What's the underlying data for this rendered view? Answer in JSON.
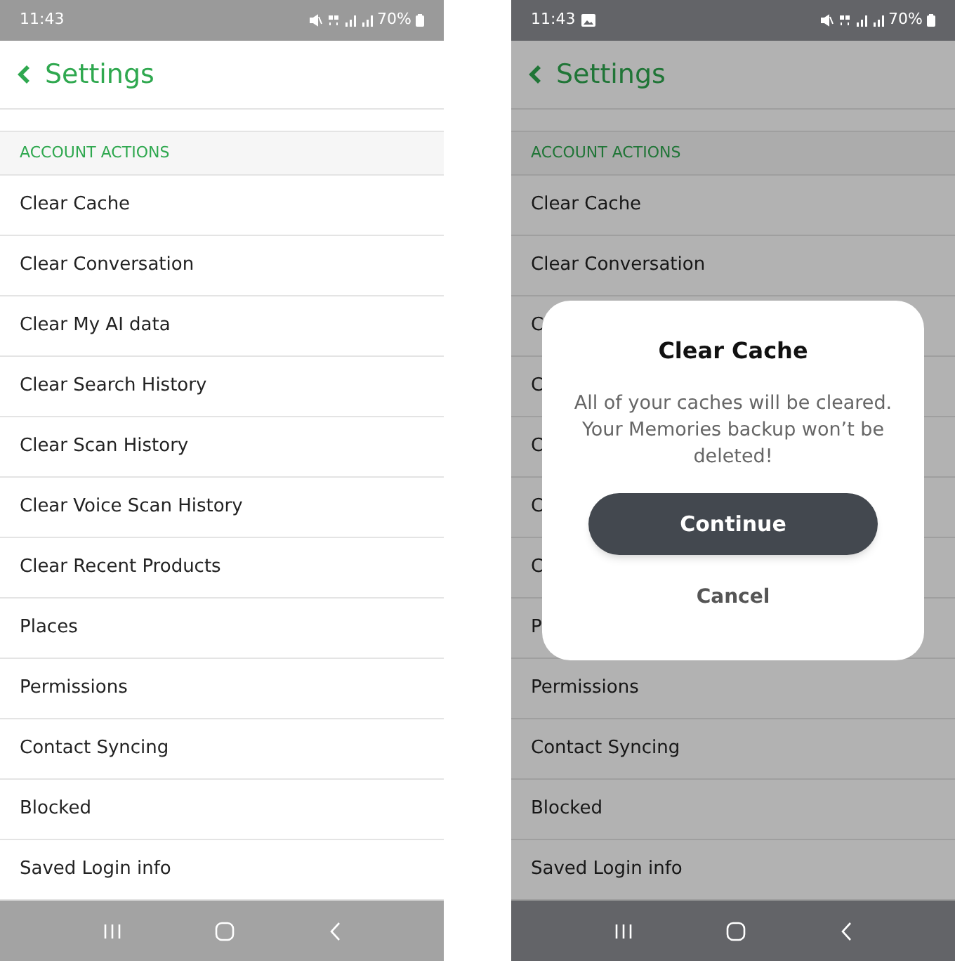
{
  "screens": [
    {
      "status_bar": {
        "time": "11:43",
        "image_notification": false,
        "battery": "70%"
      },
      "header": {
        "title": "Settings"
      },
      "section": "ACCOUNT ACTIONS",
      "items": [
        "Clear Cache",
        "Clear Conversation",
        "Clear My AI data",
        "Clear Search History",
        "Clear Scan History",
        "Clear Voice Scan History",
        "Clear Recent Products",
        "Places",
        "Permissions",
        "Contact Syncing",
        "Blocked",
        "Saved Login info"
      ]
    },
    {
      "status_bar": {
        "time": "11:43",
        "image_notification": true,
        "battery": "70%"
      },
      "header": {
        "title": "Settings"
      },
      "section": "ACCOUNT ACTIONS",
      "items": [
        "Clear Cache",
        "Clear Conversation",
        "C",
        "C",
        "C",
        "C",
        "C",
        "P",
        "Permissions",
        "Contact Syncing",
        "Blocked",
        "Saved Login info"
      ],
      "dialog": {
        "title": "Clear Cache",
        "message": "All of your caches will be cleared. Your Memories backup won’t be deleted!",
        "primary": "Continue",
        "secondary": "Cancel"
      }
    }
  ]
}
